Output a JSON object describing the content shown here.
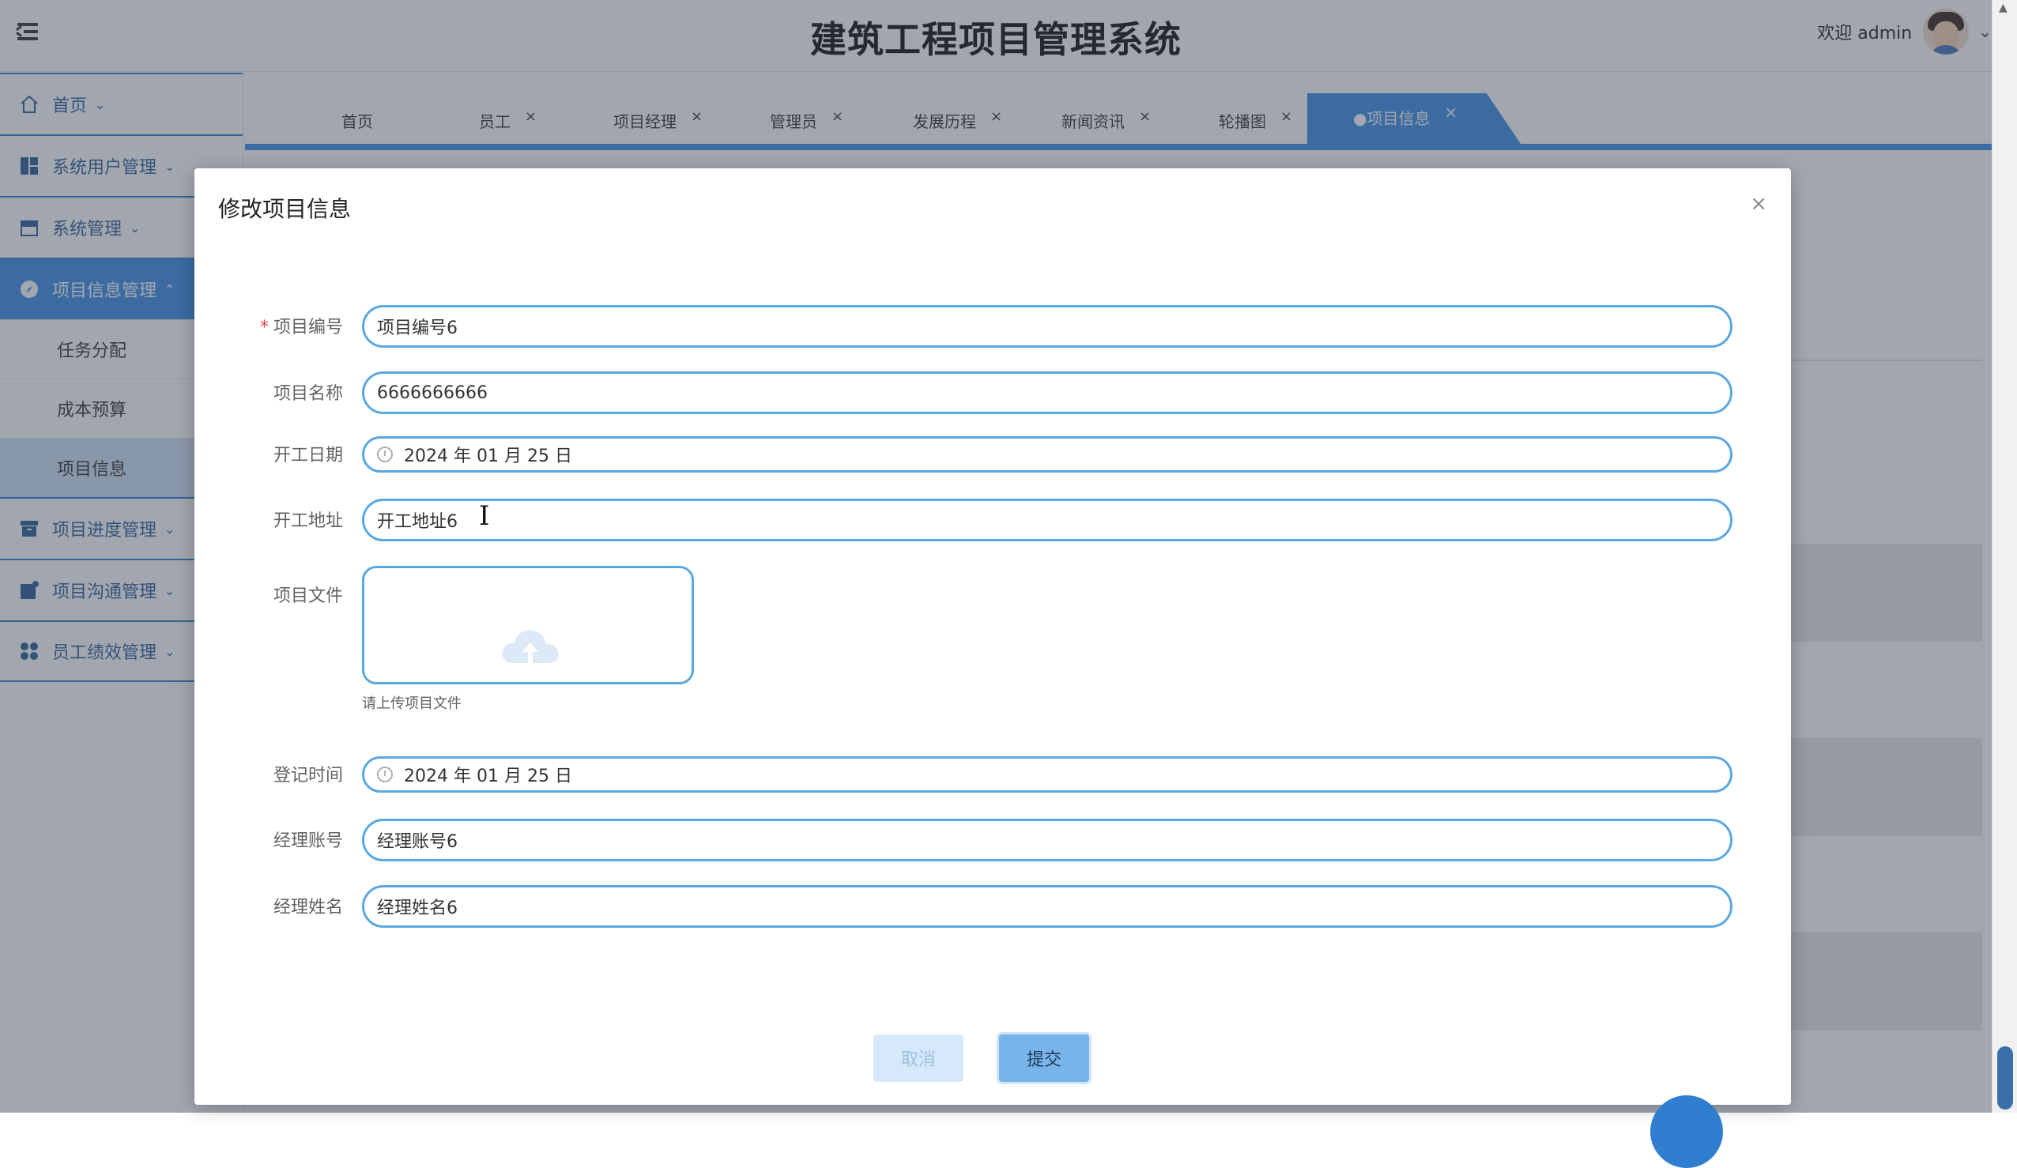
{
  "header": {
    "title": "建筑工程项目管理系统",
    "welcome": "欢迎 admin"
  },
  "sidebar": {
    "items": [
      {
        "label": "首页",
        "icon": "home-icon"
      },
      {
        "label": "系统用户管理",
        "icon": "dashboard-icon"
      },
      {
        "label": "系统管理",
        "icon": "store-icon"
      },
      {
        "label": "项目信息管理",
        "icon": "compass-icon",
        "active": true
      },
      {
        "label": "任务分配",
        "sub": true
      },
      {
        "label": "成本预算",
        "sub": true
      },
      {
        "label": "项目信息",
        "sub": true,
        "selected": true
      },
      {
        "label": "项目进度管理",
        "icon": "archive-icon"
      },
      {
        "label": "项目沟通管理",
        "icon": "notification-icon"
      },
      {
        "label": "员工绩效管理",
        "icon": "apps-icon"
      }
    ]
  },
  "tabs": {
    "items": [
      "首页",
      "员工",
      "项目经理",
      "管理员",
      "发展历程",
      "新闻资讯",
      "轮播图"
    ],
    "active": "●项目信息",
    "close": "×"
  },
  "dialog": {
    "title": "修改项目信息",
    "close": "×",
    "fields": {
      "project_no": {
        "label": "项目编号",
        "required": "*",
        "value": "项目编号6"
      },
      "project_name": {
        "label": "项目名称",
        "value": "6666666666"
      },
      "start_date": {
        "label": "开工日期",
        "value": "2024 年 01 月 25 日"
      },
      "start_address": {
        "label": "开工地址",
        "value": "开工地址6"
      },
      "project_file": {
        "label": "项目文件",
        "tip": "请上传项目文件"
      },
      "register_time": {
        "label": "登记时间",
        "value": "2024 年 01 月 25 日"
      },
      "manager_account": {
        "label": "经理账号",
        "value": "经理账号6"
      },
      "manager_name": {
        "label": "经理姓名",
        "value": "经理姓名6"
      }
    },
    "cancel_label": "取消",
    "submit_label": "提交"
  },
  "colors": {
    "accent": "#3a8ee6",
    "input_border": "#5aa8e0",
    "required": "#e84545"
  }
}
